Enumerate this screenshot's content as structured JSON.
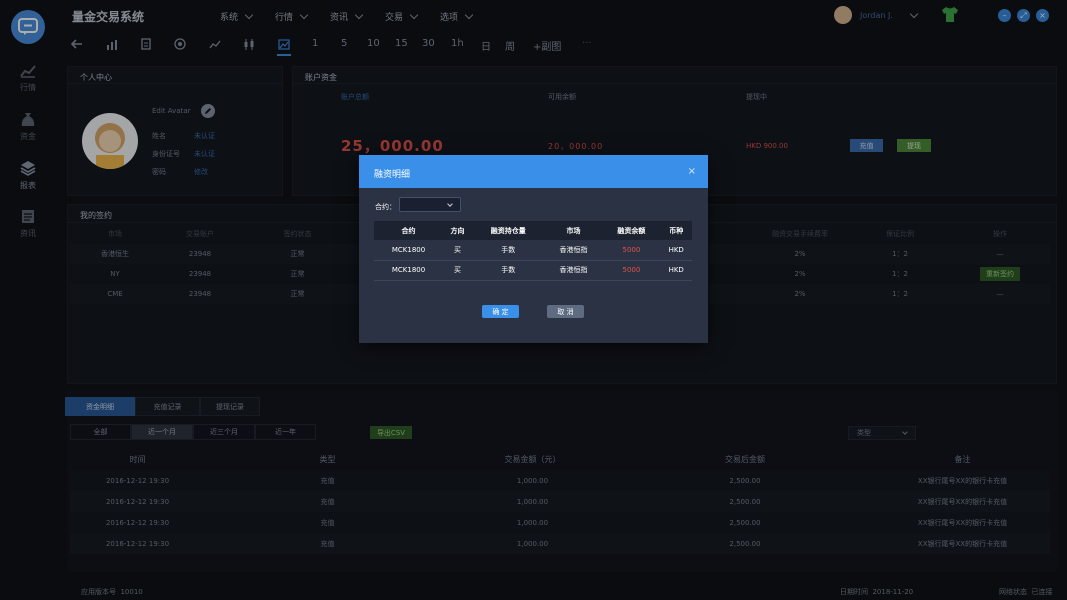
{
  "app": {
    "title": "量金交易系统"
  },
  "sidebar": {
    "items": [
      {
        "label": "行情",
        "icon": "chart-icon"
      },
      {
        "label": "资金",
        "icon": "money-bag-icon"
      },
      {
        "label": "报表",
        "icon": "layers-icon"
      },
      {
        "label": "资讯",
        "icon": "news-icon"
      }
    ]
  },
  "menu": [
    "系统",
    "行情",
    "资讯",
    "交易",
    "选项"
  ],
  "user": {
    "name": "Jordan J."
  },
  "toolbar": {
    "periods": [
      "1",
      "5",
      "10",
      "15",
      "30",
      "1h",
      "日",
      "周",
      "+副图"
    ],
    "more": "···"
  },
  "profile": {
    "title": "个人中心",
    "edit_avatar": "Edit Avatar",
    "fields": [
      {
        "label": "姓名",
        "value": "未认证"
      },
      {
        "label": "身份证号",
        "value": "未认证"
      },
      {
        "label": "密码",
        "value": "修改"
      }
    ]
  },
  "account": {
    "title": "账户资金",
    "total_label": "账户总额",
    "available_label": "可用余额",
    "withdrawing_label": "提现中",
    "total_value": "25，000.00",
    "available_value": "20，000.00",
    "withdrawing_value": "HKD 900.00",
    "deposit_button": "充值",
    "withdraw_button": "提现"
  },
  "contracts": {
    "title": "我的签约",
    "headers": [
      "市场",
      "交易账户",
      "签约状态",
      "融资交易手续费率",
      "保证比例",
      "操作"
    ],
    "rows": [
      {
        "market": "香港恒生",
        "account": "23948",
        "status": "正常",
        "rate": "2%",
        "ratio": "1：2",
        "action": "—"
      },
      {
        "market": "NY",
        "account": "23948",
        "status": "正常",
        "rate": "2%",
        "ratio": "1：2",
        "action": "重新签约"
      },
      {
        "market": "CME",
        "account": "23948",
        "status": "正常",
        "rate": "2%",
        "ratio": "1：2",
        "action": "—"
      }
    ]
  },
  "funds": {
    "tabs": [
      "资金明细",
      "充值记录",
      "提现记录"
    ],
    "ranges": [
      "全部",
      "近一个月",
      "近三个月",
      "近一年"
    ],
    "export_button": "导出CSV",
    "type_select": "类型",
    "headers": [
      "时间",
      "类型",
      "交易金额（元）",
      "交易后金额",
      "备注"
    ],
    "rows": [
      {
        "time": "2016-12-12 19:30",
        "type": "充值",
        "amount": "1,000.00",
        "after": "2,500.00",
        "note": "XX银行尾号XX的银行卡充值"
      },
      {
        "time": "2016-12-12 19:30",
        "type": "充值",
        "amount": "1,000.00",
        "after": "2,500.00",
        "note": "XX银行尾号XX的银行卡充值"
      },
      {
        "time": "2016-12-12 19:30",
        "type": "充值",
        "amount": "1,000.00",
        "after": "2,500.00",
        "note": "XX银行尾号XX的银行卡充值"
      },
      {
        "time": "2016-12-12 19:30",
        "type": "充值",
        "amount": "1,000.00",
        "after": "2,500.00",
        "note": "XX银行尾号XX的银行卡充值"
      }
    ]
  },
  "footer": {
    "version_label": "应用版本号",
    "version": "10010",
    "date_label": "日期时间",
    "date": "2018-11-20",
    "network_label": "网络状态",
    "network": "已连接"
  },
  "modal": {
    "title": "融资明细",
    "contract_label": "合约：",
    "headers": [
      "合约",
      "方向",
      "融资持仓量",
      "市场",
      "融资余额",
      "币种"
    ],
    "rows": [
      {
        "contract": "MCK1800",
        "direction": "买",
        "quantity": "手数",
        "market": "香港恒指",
        "balance": "5000",
        "currency": "HKD"
      },
      {
        "contract": "MCK1800",
        "direction": "买",
        "quantity": "手数",
        "market": "香港恒指",
        "balance": "5000",
        "currency": "HKD"
      }
    ],
    "confirm": "确 定",
    "cancel": "取 消"
  },
  "colors": {
    "accent": "#3a90e8",
    "danger": "#e0524a",
    "success": "#4e8a3c",
    "background": "#0f1218"
  }
}
